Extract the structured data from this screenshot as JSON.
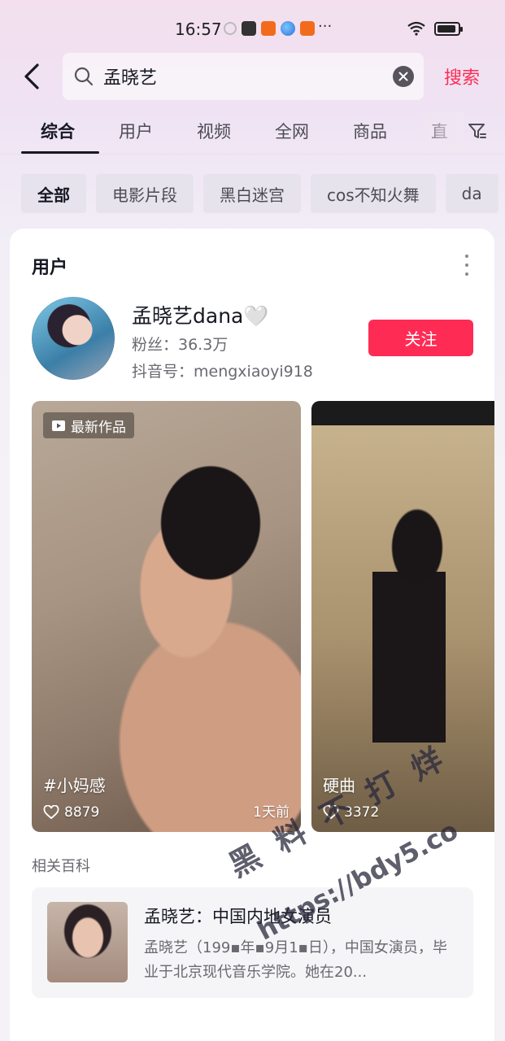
{
  "status_bar": {
    "time": "16:57",
    "more": "···"
  },
  "search": {
    "query": "孟晓艺",
    "button": "搜索"
  },
  "tabs": [
    {
      "label": "综合"
    },
    {
      "label": "用户"
    },
    {
      "label": "视频"
    },
    {
      "label": "全网"
    },
    {
      "label": "商品"
    },
    {
      "label": "直"
    }
  ],
  "chips": [
    {
      "label": "全部"
    },
    {
      "label": "电影片段"
    },
    {
      "label": "黑白迷宫"
    },
    {
      "label": "cos不知火舞"
    },
    {
      "label": "da"
    }
  ],
  "user_section": {
    "title": "用户",
    "user": {
      "name": "孟晓艺dana🤍",
      "fans": "粉丝：36.3万",
      "douyin_id": "抖音号：mengxiaoyi918",
      "follow_label": "关注"
    },
    "videos": [
      {
        "badge": "最新作品",
        "caption": "#小妈感",
        "likes": "8879",
        "time": "1天前"
      },
      {
        "caption": "硬曲",
        "likes": "3372"
      }
    ]
  },
  "baike": {
    "section_title": "相关百科",
    "title": "孟晓艺：中国内地女演员",
    "desc": "孟晓艺（199▪年▪9月1▪日），中国女演员，毕业于北京现代音乐学院。她在20..."
  },
  "watermark": {
    "line1": "黑 料 不 打 烊",
    "line2": "https://bdy5.co"
  },
  "colors": {
    "accent": "#fe2c55",
    "text_primary": "#161823",
    "text_secondary": "#6a6970"
  }
}
